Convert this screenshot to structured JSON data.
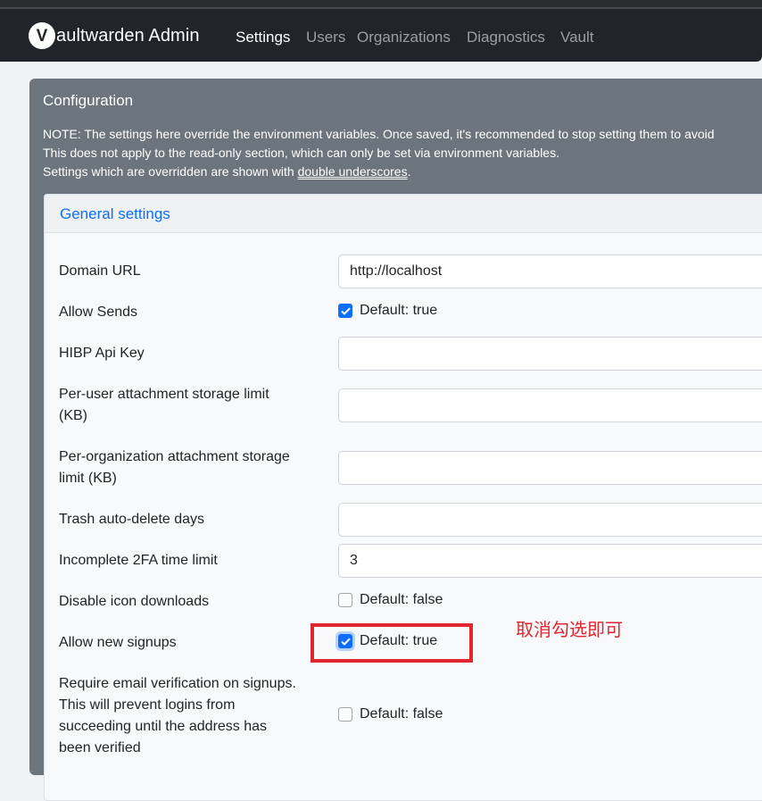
{
  "navbar": {
    "brand_letter": "V",
    "brand_text": "aultwarden Admin",
    "links": [
      {
        "label": "Settings",
        "active": true
      },
      {
        "label": "Users",
        "active": false
      },
      {
        "label": "Organizations",
        "active": false
      },
      {
        "label": "Diagnostics",
        "active": false
      },
      {
        "label": "Vault",
        "active": false
      }
    ]
  },
  "config": {
    "title": "Configuration",
    "note_line1": "NOTE: The settings here override the environment variables. Once saved, it's recommended to stop setting them to avoid",
    "note_line2": "This does not apply to the read-only section, which can only be set via environment variables.",
    "note_line3_prefix": "Settings which are overridden are shown with ",
    "note_line3_underlined": "double underscores",
    "note_line3_suffix": "."
  },
  "general": {
    "header": "General settings",
    "fields": [
      {
        "label": "Domain URL",
        "type": "text",
        "value": "http://localhost"
      },
      {
        "label": "Allow Sends",
        "type": "checkbox",
        "checked": true,
        "hint": "Default: true"
      },
      {
        "label": "HIBP Api Key",
        "type": "text",
        "value": ""
      },
      {
        "label_line1": "Per-user attachment storage limit",
        "label_line2": "(KB)",
        "type": "text",
        "value": ""
      },
      {
        "label_line1": "Per-organization attachment storage",
        "label_line2": "limit (KB)",
        "type": "text",
        "value": ""
      },
      {
        "label": "Trash auto-delete days",
        "type": "text",
        "value": ""
      },
      {
        "label": "Incomplete 2FA time limit",
        "type": "text",
        "value": "3"
      },
      {
        "label": "Disable icon downloads",
        "type": "checkbox",
        "checked": false,
        "hint": "Default: false"
      },
      {
        "label": "Allow new signups",
        "type": "checkbox",
        "checked": true,
        "hint": "Default: true"
      },
      {
        "label_line1": "Require email verification on signups.",
        "label_line2": "This will prevent logins from",
        "label_line3": "succeeding until the address has",
        "label_line4": "been verified",
        "type": "checkbox",
        "checked": false,
        "hint": "Default: false"
      }
    ]
  },
  "annotation": {
    "text": "取消勾选即可",
    "color": "#e0262f"
  },
  "colors": {
    "navbar": "#212529",
    "card": "#6c757d",
    "link": "#0d6efd",
    "checkbox_on": "#0d6efd"
  }
}
